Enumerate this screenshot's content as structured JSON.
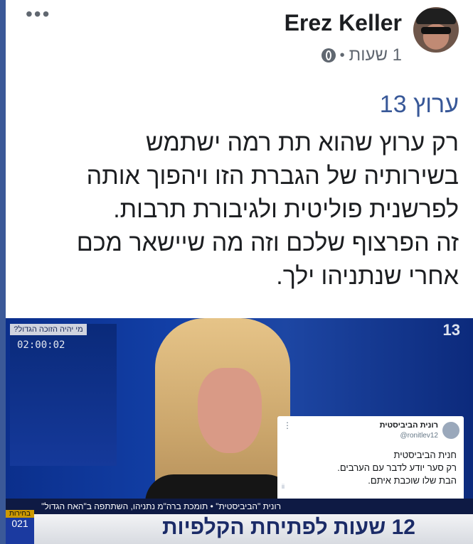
{
  "post": {
    "author_name": "Erez Keller",
    "time_label": "1 שעות",
    "separator": "•",
    "more_label": "•••",
    "mention": "ערוץ 13",
    "body_lines": [
      "רק ערוץ שהוא תת רמה ישתמש",
      "בשירותיה של הגברת הזו ויהפוך אותה",
      "לפרשנית פוליטית ולגיבורת תרבות.",
      "זה הפרצוף שלכם וזה מה שיישאר מכם",
      "אחרי שנתניהו ילך."
    ]
  },
  "media": {
    "overlay_question": "מי יהיה הזוכה הגדול?",
    "overlay_timer": "02:00:02",
    "channel_mark": "13",
    "tweet": {
      "name": "רונית הביביסטית",
      "handle": "@ronitlev12",
      "more": "⋮",
      "lines": [
        "חנית הביביסטית",
        "רק סער יודע לדבר עם הערבים.",
        "הבת שלו שוכבת איתם."
      ],
      "tag": "ii"
    },
    "ticker_top": "רונית \"הביביסטית\" • תומכת ברה\"מ נתניהו, השתתפה ב\"האח הגדול\"",
    "ticker_side_top": "בחירות",
    "ticker_side_bottom": "021",
    "headline": "12 שעות לפתיחת הקלפיות"
  },
  "colors": {
    "frame": "#3b5998",
    "mention_link": "#385898",
    "news_blue": "#123fa6"
  }
}
